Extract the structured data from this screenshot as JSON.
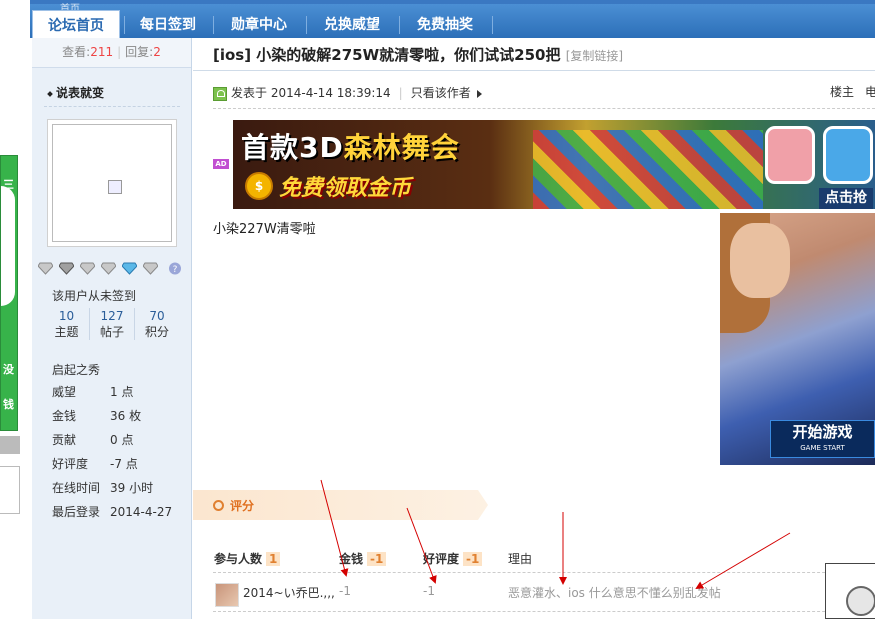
{
  "nav": {
    "tabs": [
      {
        "label": "论坛首页",
        "active": true
      },
      {
        "label": "每日签到"
      },
      {
        "label": "勋章中心"
      },
      {
        "label": "兑换威望"
      },
      {
        "label": "免费抽奖"
      }
    ],
    "ghost_text": "首页"
  },
  "floatad": {
    "glyphs": [
      "三",
      "没",
      "钱"
    ]
  },
  "sidebar": {
    "views_label": "查看:",
    "views": "211",
    "replies_label": "回复:",
    "replies": "2",
    "author": "说表就变",
    "checkin": "该用户从未签到",
    "counters": [
      {
        "value": "10",
        "label": "主题"
      },
      {
        "value": "127",
        "label": "帖子"
      },
      {
        "value": "70",
        "label": "积分"
      }
    ],
    "rank": "启起之秀",
    "profile": [
      {
        "key": "威望",
        "value": "1 点"
      },
      {
        "key": "金钱",
        "value": "36 枚"
      },
      {
        "key": "贡献",
        "value": "0 点"
      },
      {
        "key": "好评度",
        "value": "-7 点"
      },
      {
        "key": "在线时间",
        "value": "39 小时"
      },
      {
        "key": "最后登录",
        "value": "2014-4-27"
      }
    ]
  },
  "post": {
    "title": "[ios] 小染的破解275W就清零啦，你们试试250把",
    "copy_link": "[复制链接]",
    "posted_prefix": "发表于",
    "posted_at": "2014-4-14 18:39:14",
    "only_author": "只看该作者",
    "floor_label": "楼主",
    "floor_tail": "电",
    "body": "小染227W清零啦",
    "ad_badge": "AD"
  },
  "banner": {
    "line1_a": "首款3D",
    "line1_b": "森林舞会",
    "line2": "免费领取金币",
    "coin": "$",
    "cta": "点击抢"
  },
  "side_image": {
    "button_label": "开始游戏",
    "button_sub": "GAME START"
  },
  "rating": {
    "heading": "评分",
    "col_participants": "参与人数",
    "participants_count": "1",
    "col_money": "金钱",
    "money_total": "-1",
    "col_rep": "好评度",
    "rep_total": "-1",
    "col_reason": "理由",
    "rows": [
      {
        "user": "2014~い乔巴.,,,",
        "money": "-1",
        "rep": "-1",
        "reason": "恶意灌水、ios 什么意思不懂么别乱发帖"
      }
    ]
  },
  "colors": {
    "nav_blue": "#2c6fb8",
    "accent_orange": "#e07020",
    "arrow_red": "#d40000",
    "sidebar_bg": "#e9f0f8"
  }
}
